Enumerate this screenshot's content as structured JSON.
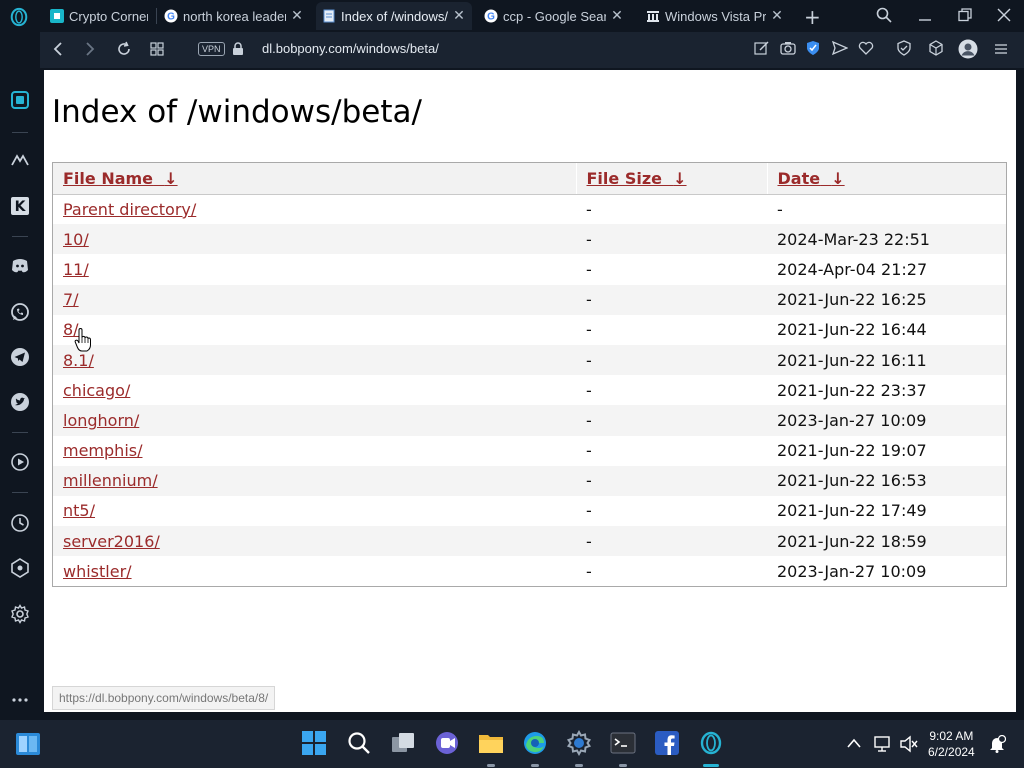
{
  "browser": {
    "tabs": [
      {
        "title": "Crypto Corner",
        "favicon": "crypto-corner-icon"
      },
      {
        "title": "north korea leader",
        "favicon": "google-icon"
      },
      {
        "title": "Index of /windows/beta/",
        "favicon": "page-icon",
        "active": true
      },
      {
        "title": "ccp - Google Search",
        "favicon": "google-icon"
      },
      {
        "title": "Windows Vista Pre",
        "favicon": "museum-icon"
      }
    ],
    "new_tab": "+",
    "vpn_label": "VPN",
    "url": "dl.bobpony.com/windows/beta/"
  },
  "page": {
    "heading": "Index of /windows/beta/",
    "columns": {
      "name": "File Name",
      "size": "File Size",
      "date": "Date",
      "sort_arrow": "↓"
    },
    "rows": [
      {
        "name": "Parent directory/",
        "size": "-",
        "date": "-"
      },
      {
        "name": "10/",
        "size": "-",
        "date": "2024-Mar-23 22:51"
      },
      {
        "name": "11/",
        "size": "-",
        "date": "2024-Apr-04 21:27"
      },
      {
        "name": "7/",
        "size": "-",
        "date": "2021-Jun-22 16:25"
      },
      {
        "name": "8/",
        "size": "-",
        "date": "2021-Jun-22 16:44"
      },
      {
        "name": "8.1/",
        "size": "-",
        "date": "2021-Jun-22 16:11"
      },
      {
        "name": "chicago/",
        "size": "-",
        "date": "2021-Jun-22 23:37"
      },
      {
        "name": "longhorn/",
        "size": "-",
        "date": "2023-Jan-27 10:09"
      },
      {
        "name": "memphis/",
        "size": "-",
        "date": "2021-Jun-22 19:07"
      },
      {
        "name": "millennium/",
        "size": "-",
        "date": "2021-Jun-22 16:53"
      },
      {
        "name": "nt5/",
        "size": "-",
        "date": "2021-Jun-22 17:49"
      },
      {
        "name": "server2016/",
        "size": "-",
        "date": "2021-Jun-22 18:59"
      },
      {
        "name": "whistler/",
        "size": "-",
        "date": "2023-Jan-27 10:09"
      }
    ],
    "status_url": "https://dl.bobpony.com/windows/beta/8/"
  },
  "taskbar": {
    "time": "9:02 AM",
    "date": "6/2/2024"
  },
  "colors": {
    "link": "#9b2b2b",
    "chrome_bg": "#0f1620",
    "toolbar_bg": "#1a2330",
    "taskbar_bg": "#1b2330"
  }
}
